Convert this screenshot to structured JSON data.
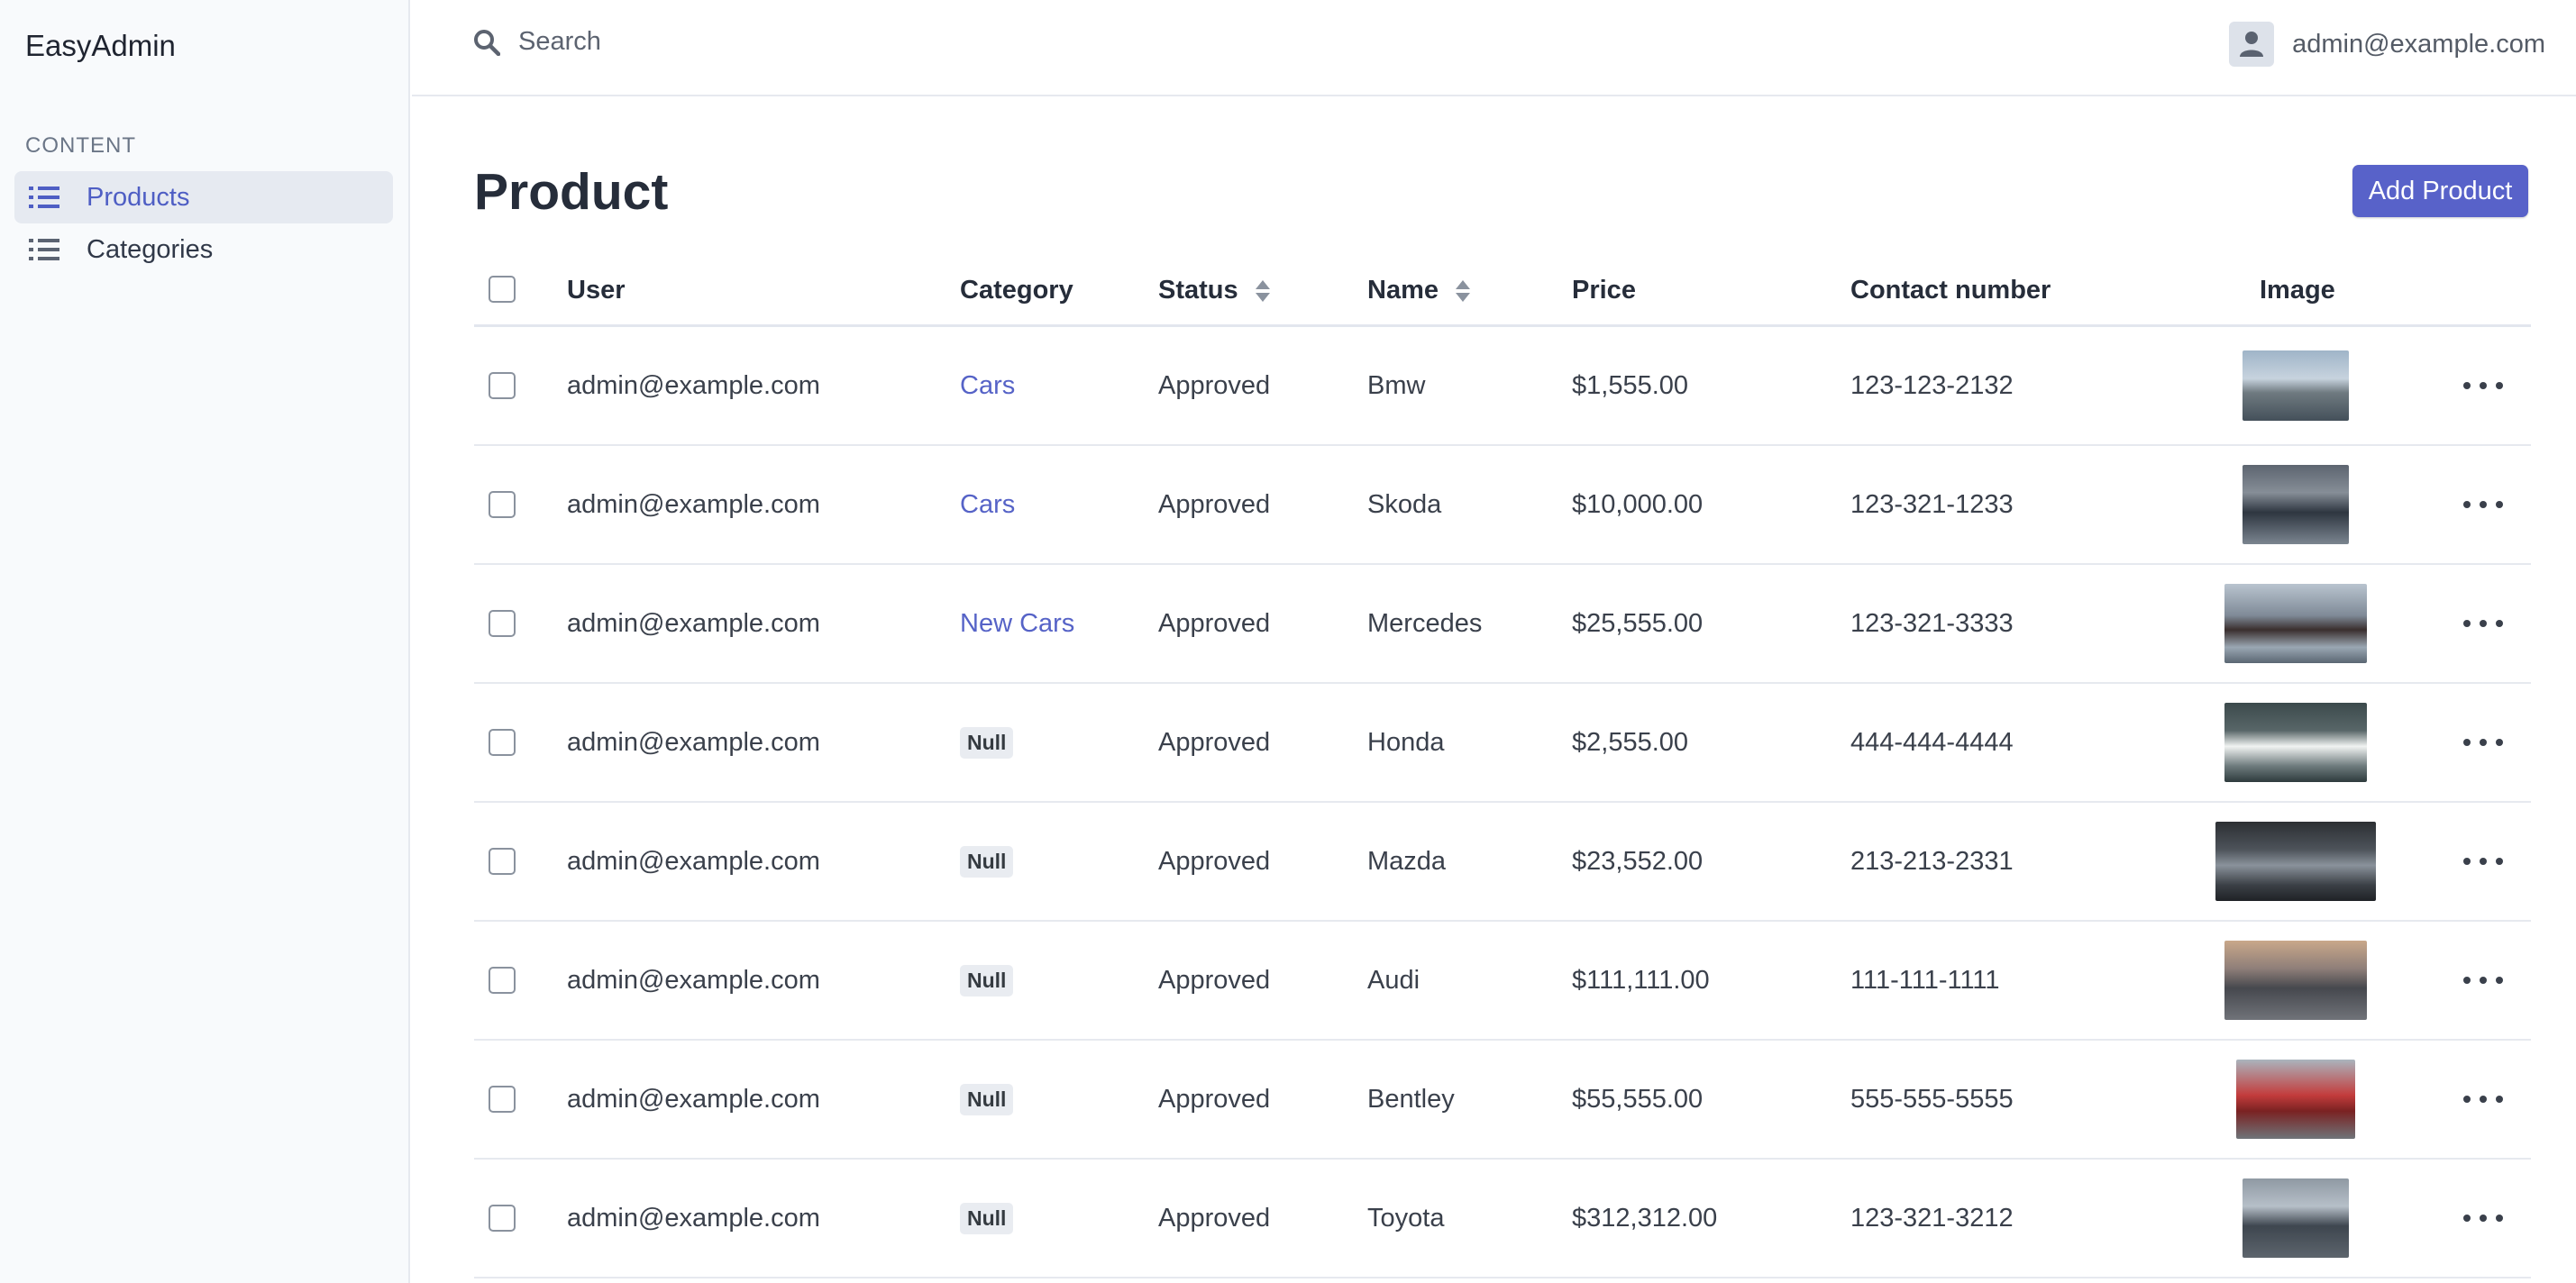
{
  "app": {
    "brand": "EasyAdmin"
  },
  "sidebar": {
    "section_header": "CONTENT",
    "items": [
      {
        "label": "Products",
        "icon": "list-icon",
        "active": true
      },
      {
        "label": "Categories",
        "icon": "list-icon",
        "active": false
      }
    ]
  },
  "header": {
    "search_placeholder": "Search",
    "search_icon": "search-icon",
    "user_email": "admin@example.com",
    "user_icon": "user-icon"
  },
  "page": {
    "title": "Product",
    "add_button_label": "Add Product"
  },
  "table": {
    "columns": [
      "User",
      "Category",
      "Status",
      "Name",
      "Price",
      "Contact number",
      "Image"
    ],
    "sortable_columns": [
      "Status",
      "Name"
    ],
    "rows": [
      {
        "user": "admin@example.com",
        "category": "Cars",
        "category_type": "link",
        "status": "Approved",
        "name": "Bmw",
        "price": "$1,555.00",
        "contact": "123-123-2132",
        "image": "bmw-car-photo"
      },
      {
        "user": "admin@example.com",
        "category": "Cars",
        "category_type": "link",
        "status": "Approved",
        "name": "Skoda",
        "price": "$10,000.00",
        "contact": "123-321-1233",
        "image": "skoda-car-photo"
      },
      {
        "user": "admin@example.com",
        "category": "New Cars",
        "category_type": "link",
        "status": "Approved",
        "name": "Mercedes",
        "price": "$25,555.00",
        "contact": "123-321-3333",
        "image": "mercedes-car-photo"
      },
      {
        "user": "admin@example.com",
        "category": "Null",
        "category_type": "badge",
        "status": "Approved",
        "name": "Honda",
        "price": "$2,555.00",
        "contact": "444-444-4444",
        "image": "honda-car-photo"
      },
      {
        "user": "admin@example.com",
        "category": "Null",
        "category_type": "badge",
        "status": "Approved",
        "name": "Mazda",
        "price": "$23,552.00",
        "contact": "213-213-2331",
        "image": "mazda-car-photo"
      },
      {
        "user": "admin@example.com",
        "category": "Null",
        "category_type": "badge",
        "status": "Approved",
        "name": "Audi",
        "price": "$111,111.00",
        "contact": "111-111-1111",
        "image": "audi-car-photo"
      },
      {
        "user": "admin@example.com",
        "category": "Null",
        "category_type": "badge",
        "status": "Approved",
        "name": "Bentley",
        "price": "$55,555.00",
        "contact": "555-555-5555",
        "image": "bentley-car-photo"
      },
      {
        "user": "admin@example.com",
        "category": "Null",
        "category_type": "badge",
        "status": "Approved",
        "name": "Toyota",
        "price": "$312,312.00",
        "contact": "123-321-3212",
        "image": "toyota-car-photo"
      }
    ]
  },
  "colors": {
    "accent": "#5862c9",
    "link": "#5663c7",
    "sidebar_bg": "#f8fafc",
    "active_item_bg": "#e6eaf1"
  }
}
